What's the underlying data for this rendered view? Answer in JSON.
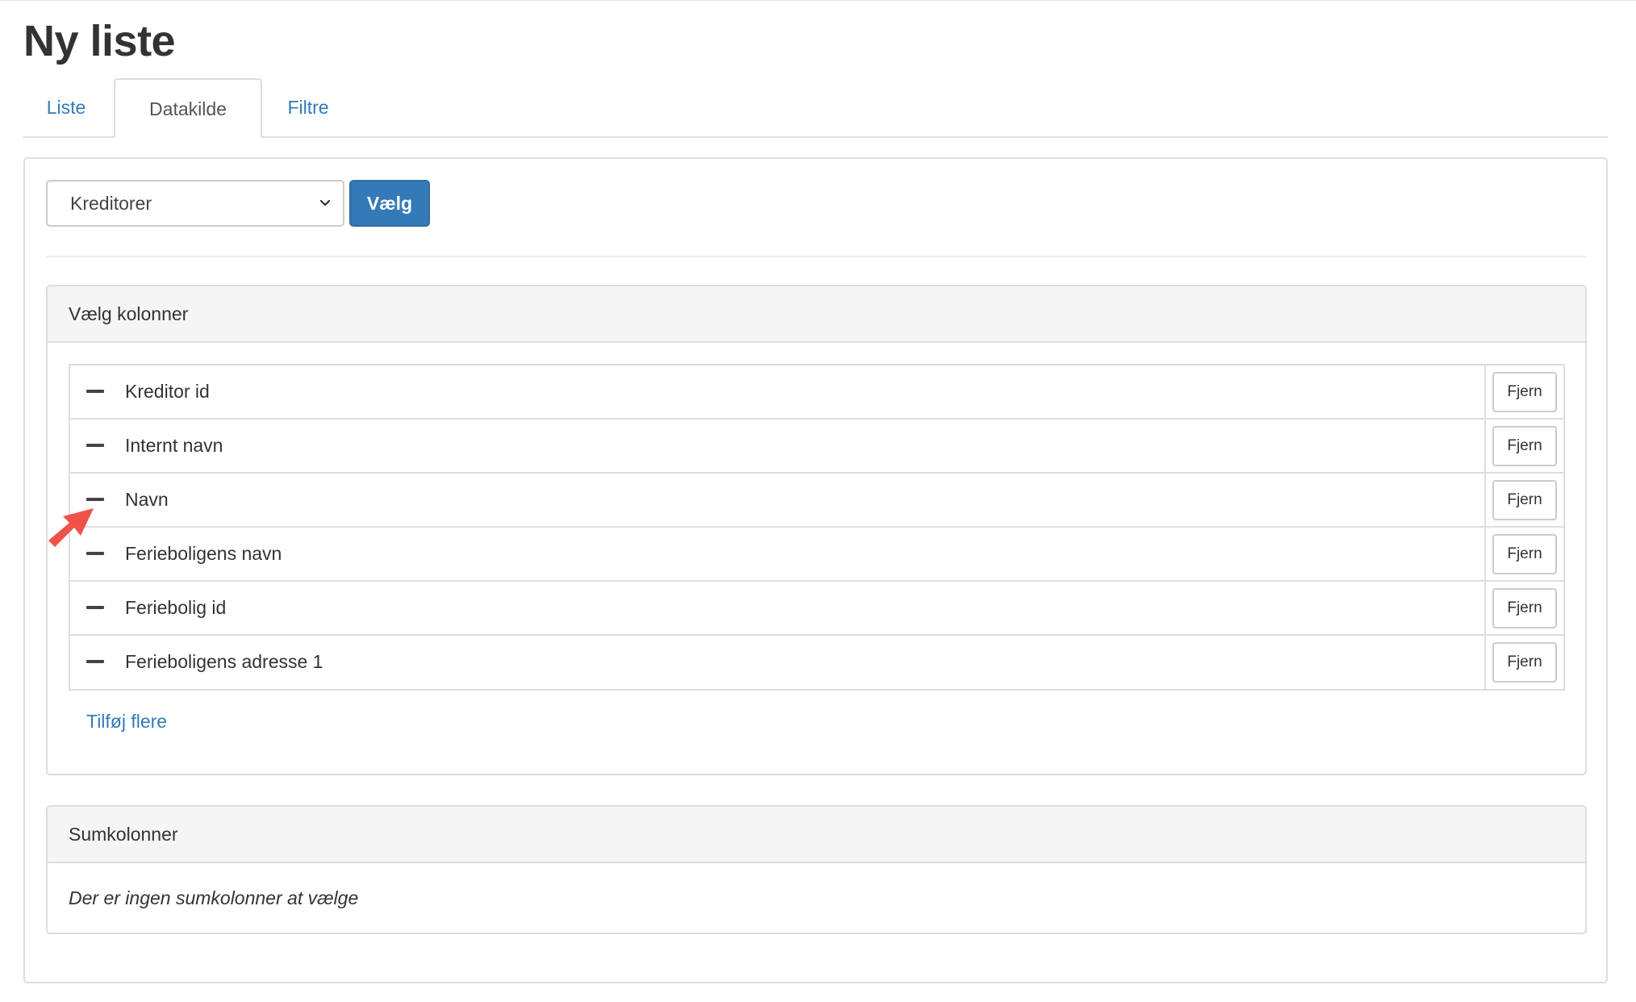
{
  "page": {
    "title": "Ny liste"
  },
  "tabs": [
    {
      "label": "Liste",
      "active": false
    },
    {
      "label": "Datakilde",
      "active": true
    },
    {
      "label": "Filtre",
      "active": false
    }
  ],
  "datasource": {
    "selected": "Kreditorer",
    "choose_label": "Vælg"
  },
  "columns_panel": {
    "heading": "Vælg kolonner",
    "columns": [
      {
        "label": "Kreditor id",
        "remove_label": "Fjern"
      },
      {
        "label": "Internt navn",
        "remove_label": "Fjern"
      },
      {
        "label": "Navn",
        "remove_label": "Fjern"
      },
      {
        "label": "Ferieboligens navn",
        "remove_label": "Fjern"
      },
      {
        "label": "Feriebolig id",
        "remove_label": "Fjern"
      },
      {
        "label": "Ferieboligens adresse 1",
        "remove_label": "Fjern"
      }
    ],
    "add_more_label": "Tilføj flere"
  },
  "sum_panel": {
    "heading": "Sumkolonner",
    "empty_text": "Der er ingen sumkolonner at vælge"
  },
  "colors": {
    "link": "#337ab7",
    "primary_button": "#337ab7",
    "annotation_arrow": "#f0524a"
  },
  "icons": {
    "select_caret": "chevron-down-icon",
    "drag_handle": "drag-handle-icon",
    "annotation": "arrow-annotation-icon"
  }
}
